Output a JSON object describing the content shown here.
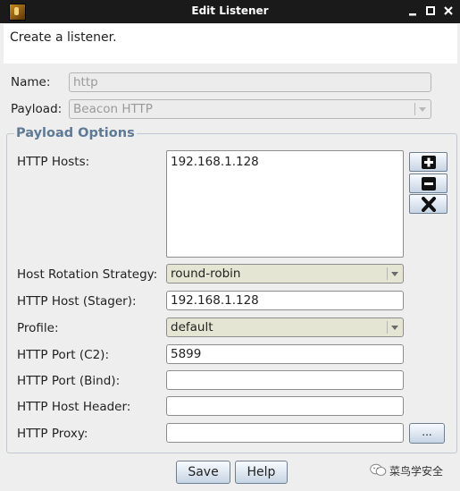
{
  "window": {
    "title": "Edit Listener",
    "icon": "app-icon",
    "controls": [
      "minimize-icon",
      "maximize-icon",
      "close-icon"
    ]
  },
  "description": "Create a listener.",
  "form": {
    "name_label": "Name:",
    "name_placeholder": "http",
    "payload_label": "Payload:",
    "payload_value": "Beacon HTTP"
  },
  "payload_options": {
    "title": "Payload Options",
    "hosts_label": "HTTP Hosts:",
    "hosts": [
      "192.168.1.128"
    ],
    "host_buttons": [
      "add-icon",
      "remove-icon",
      "clear-icon"
    ],
    "rotation_label": "Host Rotation Strategy:",
    "rotation_value": "round-robin",
    "stager_label": "HTTP Host (Stager):",
    "stager_value": "192.168.1.128",
    "profile_label": "Profile:",
    "profile_value": "default",
    "port_c2_label": "HTTP Port (C2):",
    "port_c2_value": "5899",
    "port_bind_label": "HTTP Port (Bind):",
    "port_bind_value": "",
    "host_header_label": "HTTP Host Header:",
    "host_header_value": "",
    "proxy_label": "HTTP Proxy:",
    "proxy_value": "",
    "proxy_button": "..."
  },
  "buttons": {
    "save": "Save",
    "help": "Help"
  },
  "watermark": "菜鸟学安全",
  "colors": {
    "titlebar": "#1a1a1a",
    "group_title": "#5e7a95",
    "combo_bg": "#e4e5d2",
    "window_bg": "#eeeeee"
  }
}
